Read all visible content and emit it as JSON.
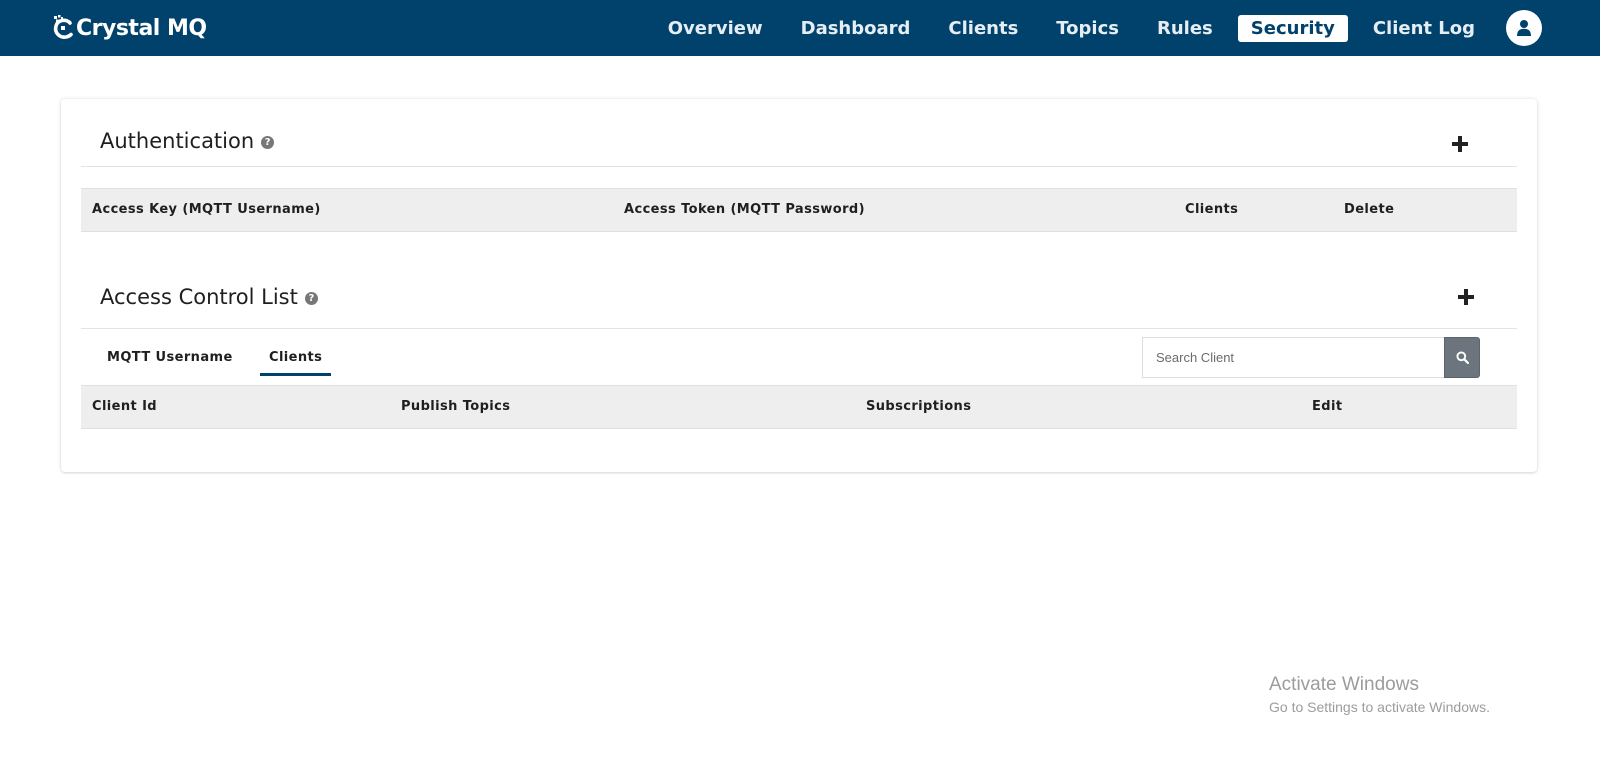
{
  "colors": {
    "navbar_bg": "#00426b",
    "active_tab_underline": "#00426b",
    "search_button": "#6c757d"
  },
  "brand": {
    "name": "Crystal MQ",
    "icon": "crystal-logo-icon"
  },
  "nav": {
    "items": [
      {
        "label": "Overview"
      },
      {
        "label": "Dashboard"
      },
      {
        "label": "Clients"
      },
      {
        "label": "Topics"
      },
      {
        "label": "Rules"
      },
      {
        "label": "Security",
        "active": true
      },
      {
        "label": "Client Log"
      }
    ],
    "user_icon": "user-icon"
  },
  "authentication": {
    "title": "Authentication",
    "help_icon": "question-circle-icon",
    "add_icon": "plus-icon",
    "columns": [
      "Access Key (MQTT Username)",
      "Access Token (MQTT Password)",
      "Clients",
      "Delete"
    ],
    "rows": []
  },
  "acl": {
    "title": "Access Control List",
    "help_icon": "question-circle-icon",
    "add_icon": "plus-icon",
    "tabs": [
      {
        "label": "MQTT Username"
      },
      {
        "label": "Clients",
        "active": true
      }
    ],
    "search": {
      "placeholder": "Search Client",
      "value": "",
      "button_icon": "search-icon"
    },
    "columns": [
      "Client Id",
      "Publish Topics",
      "Subscriptions",
      "Edit"
    ],
    "rows": []
  },
  "watermark": {
    "title": "Activate Windows",
    "subtitle": "Go to Settings to activate Windows."
  }
}
